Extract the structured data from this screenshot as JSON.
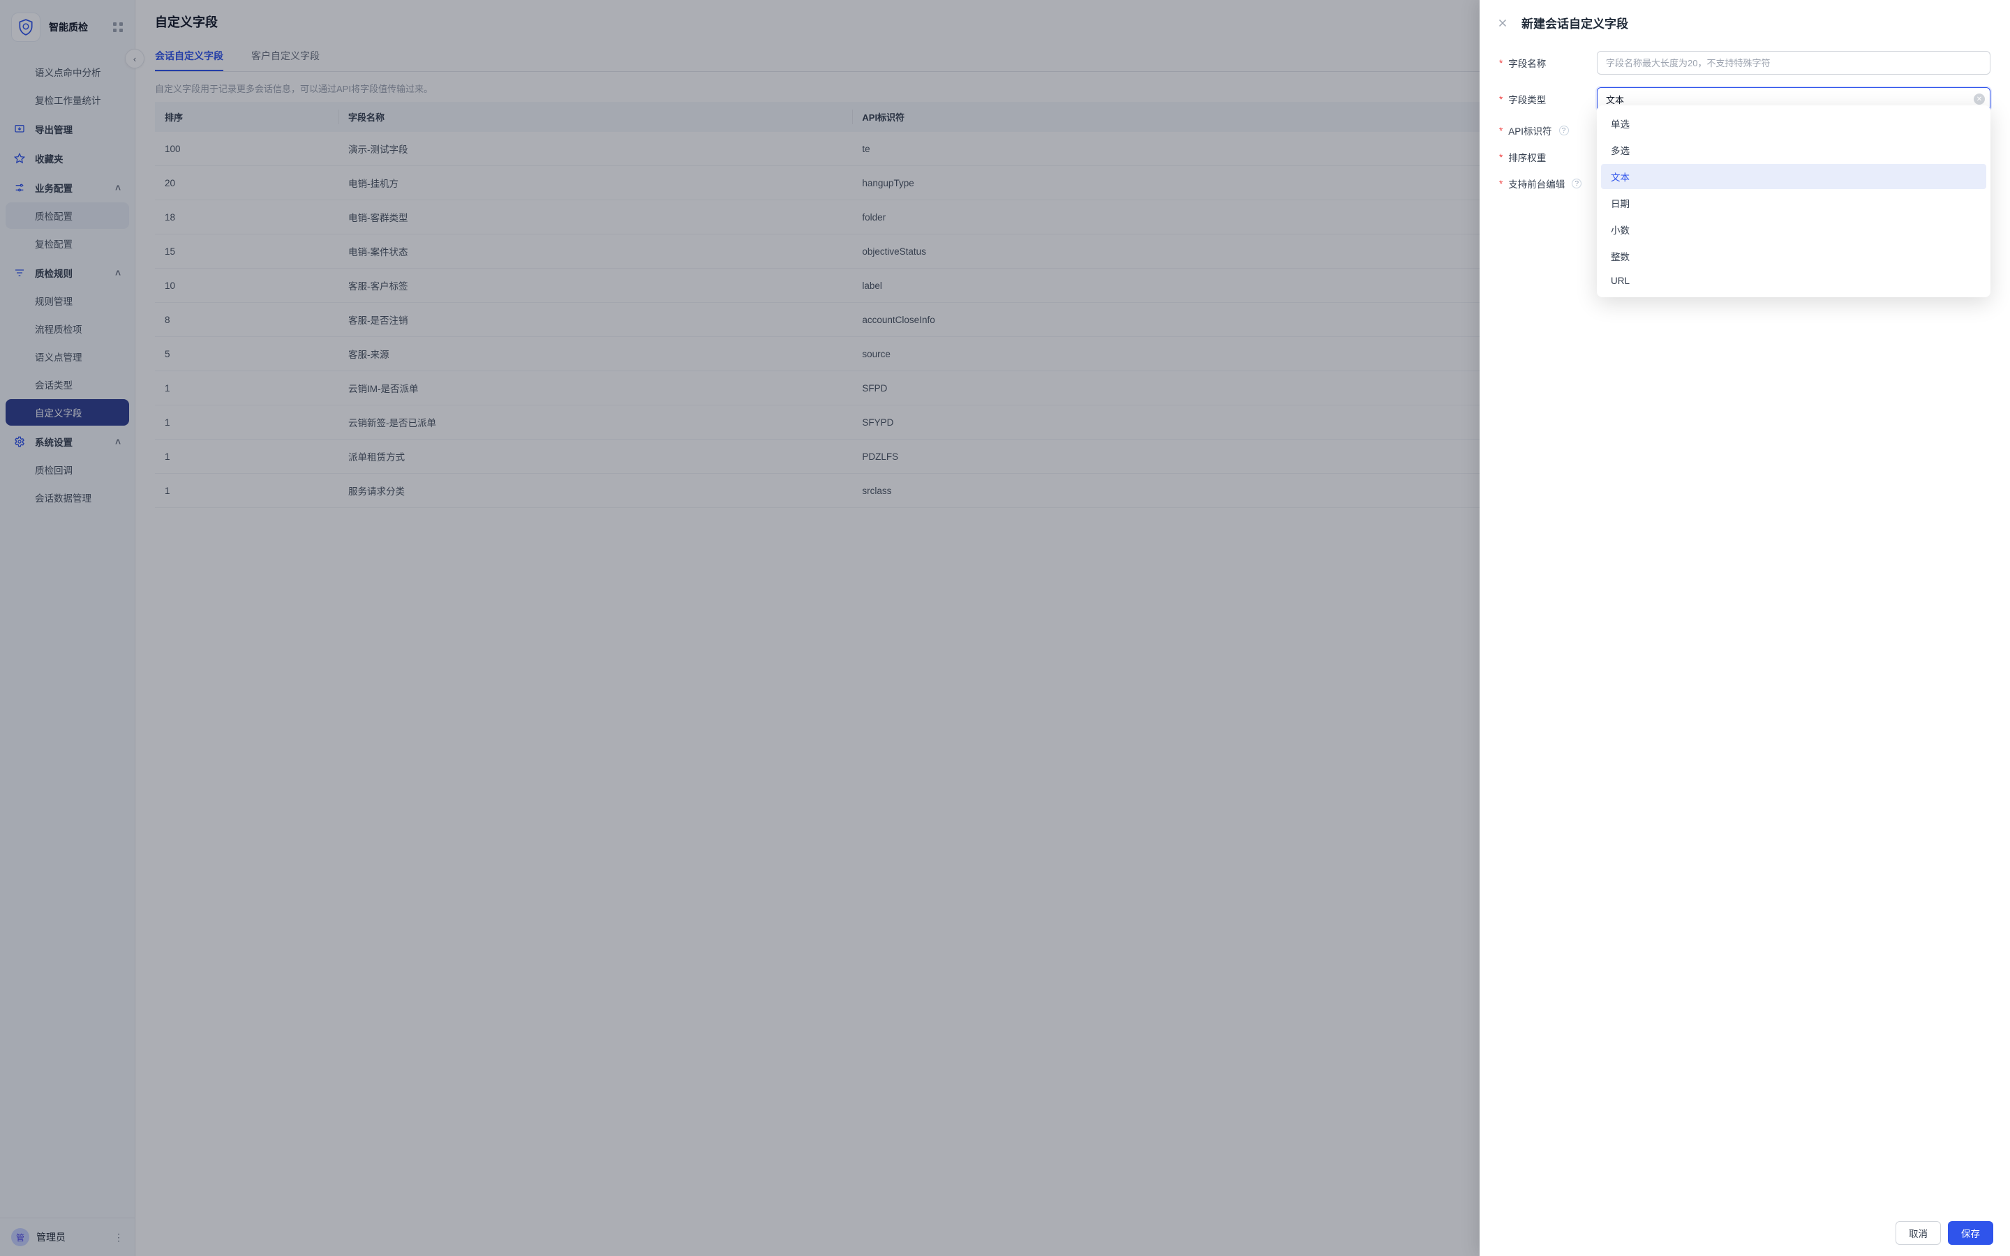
{
  "brand": {
    "title": "智能质检"
  },
  "sidebar": {
    "plain_subs": [
      "语义点命中分析",
      "复检工作量统计"
    ],
    "export": "导出管理",
    "favorites": "收藏夹",
    "biz": {
      "label": "业务配置",
      "subs": [
        "质检配置",
        "复检配置"
      ]
    },
    "rules": {
      "label": "质检规则",
      "subs": [
        "规则管理",
        "流程质检项",
        "语义点管理",
        "会话类型",
        "自定义字段"
      ]
    },
    "sys": {
      "label": "系统设置",
      "subs": [
        "质检回调",
        "会话数据管理"
      ]
    }
  },
  "user": {
    "avatar": "管",
    "name": "管理员"
  },
  "page": {
    "title": "自定义字段",
    "tabs": [
      "会话自定义字段",
      "客户自定义字段"
    ],
    "desc": "自定义字段用于记录更多会话信息，可以通过API将字段值传输过来。",
    "cols": [
      "排序",
      "字段名称",
      "API标识符"
    ],
    "rows": [
      {
        "sort": "100",
        "name": "演示-测试字段",
        "api": "te"
      },
      {
        "sort": "20",
        "name": "电销-挂机方",
        "api": "hangupType"
      },
      {
        "sort": "18",
        "name": "电销-客群类型",
        "api": "folder"
      },
      {
        "sort": "15",
        "name": "电销-案件状态",
        "api": "objectiveStatus"
      },
      {
        "sort": "10",
        "name": "客服-客户标签",
        "api": "label"
      },
      {
        "sort": "8",
        "name": "客服-是否注销",
        "api": "accountCloseInfo"
      },
      {
        "sort": "5",
        "name": "客服-来源",
        "api": "source"
      },
      {
        "sort": "1",
        "name": "云销IM-是否派单",
        "api": "SFPD"
      },
      {
        "sort": "1",
        "name": "云销新签-是否已派单",
        "api": "SFYPD"
      },
      {
        "sort": "1",
        "name": "派单租赁方式",
        "api": "PDZLFS"
      },
      {
        "sort": "1",
        "name": "服务请求分类",
        "api": "srclass"
      }
    ]
  },
  "drawer": {
    "title": "新建会话自定义字段",
    "fields": {
      "name": {
        "label": "字段名称",
        "placeholder": "字段名称最大长度为20，不支持特殊字符"
      },
      "type": {
        "label": "字段类型",
        "value": "文本",
        "options": [
          "单选",
          "多选",
          "文本",
          "日期",
          "小数",
          "整数",
          "URL"
        ]
      },
      "api": {
        "label": "API标识符"
      },
      "sort": {
        "label": "排序权重"
      },
      "edit": {
        "label": "支持前台编辑"
      }
    },
    "buttons": {
      "cancel": "取消",
      "save": "保存"
    }
  }
}
